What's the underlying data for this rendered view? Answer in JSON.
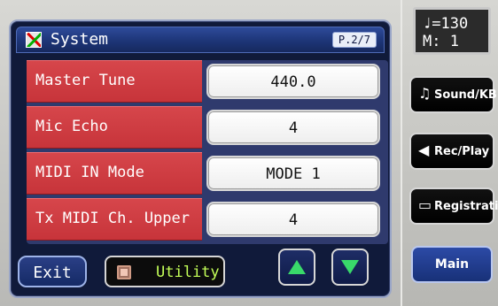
{
  "screen": {
    "title": "System",
    "page_indicator": "P.2/7"
  },
  "settings_rows": [
    {
      "label": "Master Tune",
      "value": "440.0"
    },
    {
      "label": "Mic Echo",
      "value": "4"
    },
    {
      "label": "MIDI IN Mode",
      "value": "MODE 1"
    },
    {
      "label": "Tx MIDI Ch. Upper",
      "value": "4"
    }
  ],
  "bottom": {
    "exit_label": "Exit",
    "utility_label": "Utility"
  },
  "right_panel": {
    "tempo_line1": "♩=130",
    "tempo_line2": "M:  1",
    "buttons": [
      {
        "label": "Sound/KBD",
        "icon": "music-note-icon"
      },
      {
        "label": "Rec/Play",
        "icon": "speaker-icon"
      },
      {
        "label": "Registration",
        "icon": "book-icon"
      }
    ],
    "main_label": "Main"
  },
  "colors": {
    "accent_green": "#39d96a",
    "row_red": "#c7343a",
    "panel_navy": "#101a3a",
    "utility_text": "#c4ff58"
  }
}
